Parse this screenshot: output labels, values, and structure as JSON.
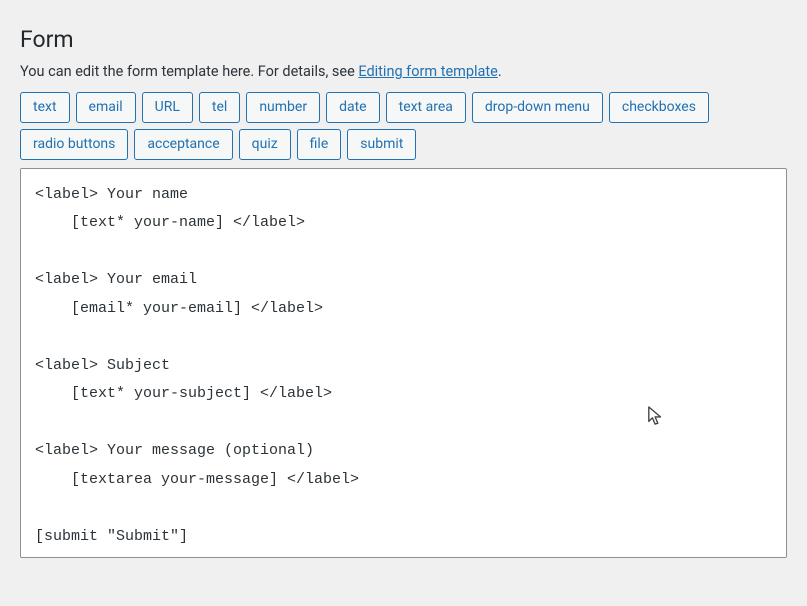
{
  "heading": "Form",
  "description_pre": "You can edit the form template here. For details, see ",
  "description_link": "Editing form template",
  "description_post": ".",
  "tag_buttons": [
    "text",
    "email",
    "URL",
    "tel",
    "number",
    "date",
    "text area",
    "drop-down menu",
    "checkboxes",
    "radio buttons",
    "acceptance",
    "quiz",
    "file",
    "submit"
  ],
  "editor_value": "<label> Your name\n    [text* your-name] </label>\n\n<label> Your email\n    [email* your-email] </label>\n\n<label> Subject\n    [text* your-subject] </label>\n\n<label> Your message (optional)\n    [textarea your-message] </label>\n\n[submit \"Submit\"]"
}
